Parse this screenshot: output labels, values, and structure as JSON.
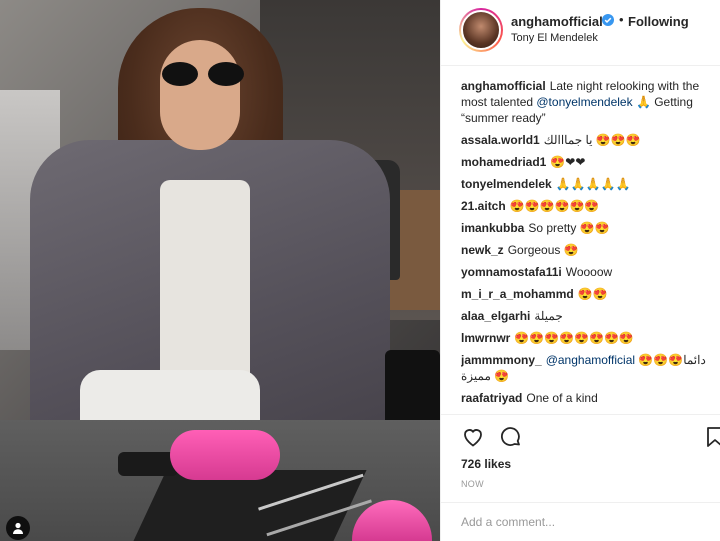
{
  "post": {
    "username": "anghamofficial",
    "follow_status": "Following",
    "separator": "•",
    "location": "Tony El Mendelek"
  },
  "comments": [
    {
      "author": "anghamofficial",
      "text": "Late night relooking with the most talented ",
      "mention": "@tonyelmendelek",
      "text_after": " 🙏 Getting “summer ready”"
    },
    {
      "author": "assala.world1",
      "text": "يا جمااالك 😍😍😍"
    },
    {
      "author": "mohamedriad1",
      "text": "😍❤❤"
    },
    {
      "author": "tonyelmendelek",
      "text": "🙏🙏🙏🙏🙏"
    },
    {
      "author": "21.aitch",
      "text": "😍😍😍😍😍😍"
    },
    {
      "author": "imankubba",
      "text": "So pretty 😍😍"
    },
    {
      "author": "newk_z",
      "text": "Gorgeous 😍"
    },
    {
      "author": "yomnamostafa11i",
      "text": "Woooow"
    },
    {
      "author": "m_i_r_a_mohammd",
      "text": "😍😍"
    },
    {
      "author": "alaa_elgarhi",
      "text": "جميلة"
    },
    {
      "author": "lmwrnwr",
      "text": "😍😍😍😍😍😍😍😍"
    },
    {
      "author": "jammmmony_",
      "mention": "@anghamofficial",
      "text": " دائما😍😍😍😍 مميزة"
    },
    {
      "author": "raafatriyad",
      "text": "One of a kind"
    }
  ],
  "engagement": {
    "likes": "726 likes",
    "time": "NOW"
  },
  "add_comment": {
    "placeholder": "Add a comment..."
  },
  "icons": {
    "like": "heart-icon",
    "comment": "speech-bubble-icon",
    "save": "bookmark-icon",
    "verified": "verified-badge-icon",
    "tagged": "person-tag-icon"
  },
  "colors": {
    "verified": "#3897f0",
    "mention": "#003569",
    "muted": "#999999",
    "dryer_pink": "#ff5fb6"
  }
}
